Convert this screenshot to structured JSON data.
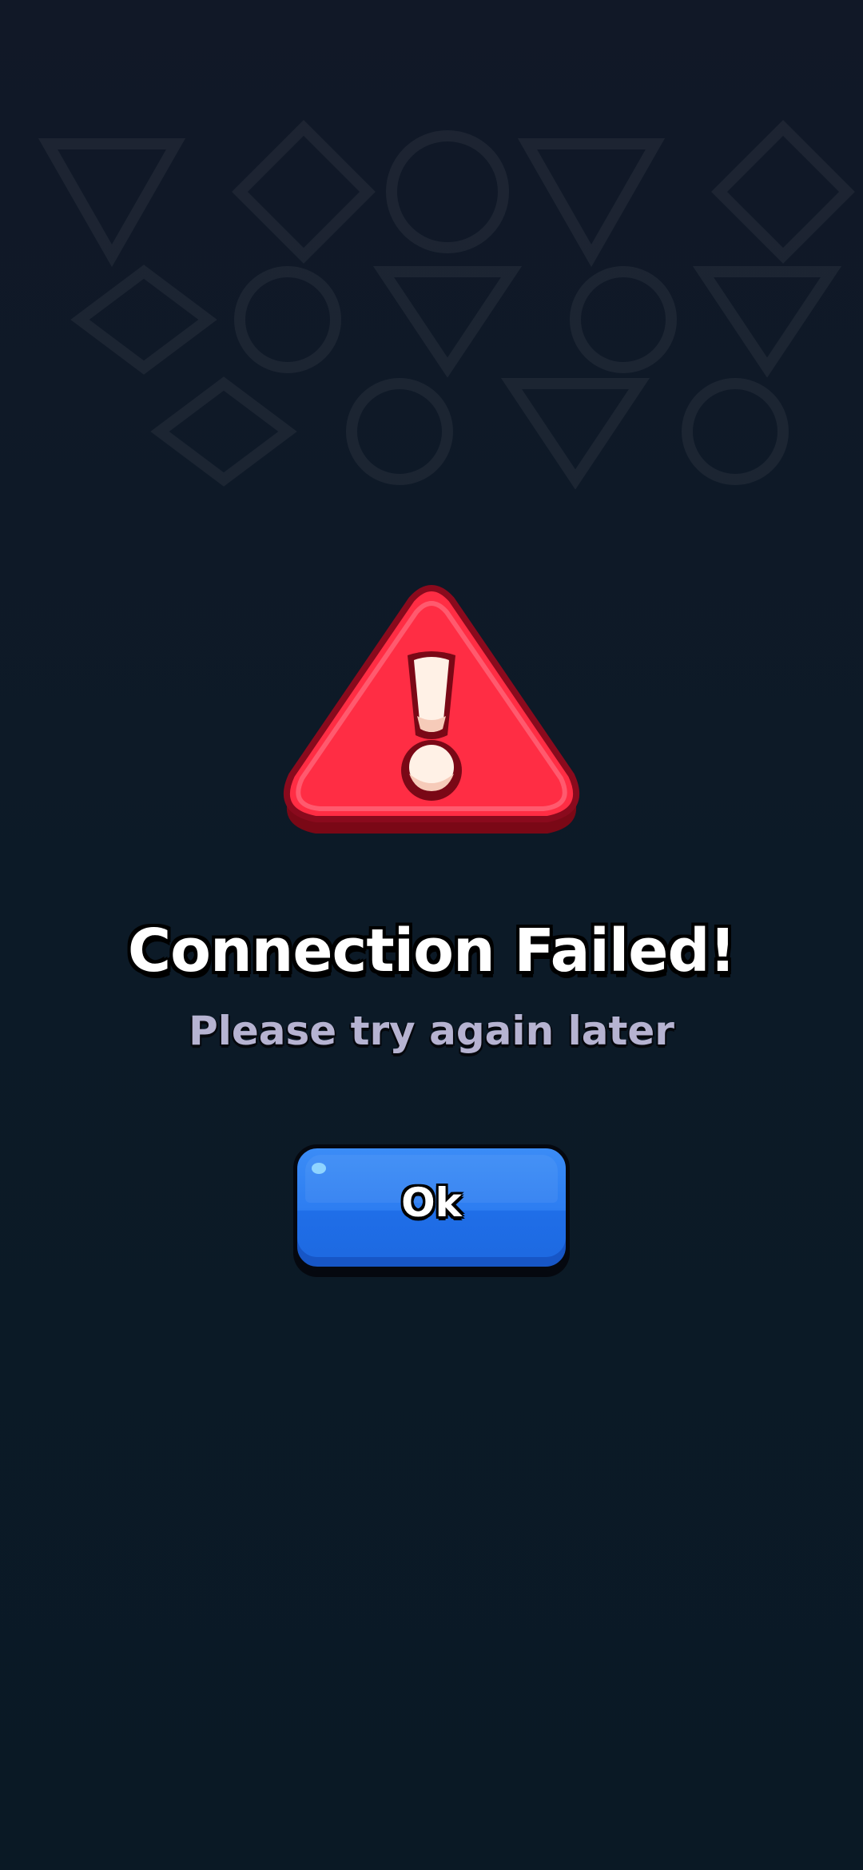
{
  "dialog": {
    "title": "Connection Failed!",
    "message": "Please try again later",
    "icon": "warning-triangle-icon",
    "ok_button": {
      "label": "Ok"
    }
  },
  "colors": {
    "background_top": "#111827",
    "background_bottom": "#0a1925",
    "warning_red": "#ff2d44",
    "warning_dark": "#8a0a1d",
    "button_blue": "#2d7df1",
    "subtitle_color": "#b6b3d1"
  }
}
